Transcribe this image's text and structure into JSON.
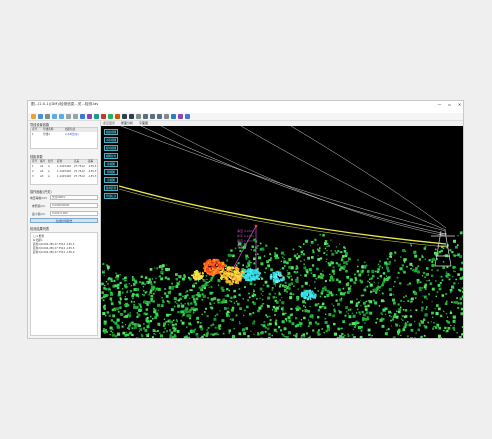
{
  "window": {
    "title": "图...(2.0-1)(DM)/检测信息...关...检测.las"
  },
  "titlebar": {
    "minimize": "—",
    "maximize": "▫",
    "close": "✕"
  },
  "menu": [
    "文件(F)",
    "检测(D)",
    "显示",
    "编辑(E)",
    "工具(T)",
    "帮助(H)"
  ],
  "toolbar": {
    "icons": [
      "open-icon",
      "save-icon",
      "undo-icon",
      "zoom-in-icon",
      "zoom-out-icon",
      "pan-icon",
      "rotate-icon",
      "select-icon",
      "measure-icon",
      "ruler-icon",
      "cut-icon",
      "layer-icon",
      "color-icon",
      "point-icon",
      "line-icon",
      "box-icon",
      "view-front-icon",
      "view-top-icon",
      "view-side-icon",
      "settings-icon",
      "export-icon",
      "report-icon",
      "help-icon"
    ]
  },
  "left_panel": {
    "section1": {
      "title": "导线设置线路",
      "columns": [
        "序号",
        "导线名称",
        "档距信息"
      ],
      "rows": [
        {
          "c1": "1",
          "c2": "导线1",
          "c3": "2-3#档(左)"
        }
      ]
    },
    "section2": {
      "title": "档距参数",
      "columns": [
        "序号",
        "编号",
        "档号",
        "距离",
        "高差",
        "弧垂"
      ],
      "rows": [
        {
          "c1": "1",
          "c2": "A1",
          "c3": "A",
          "c4": "1.1415402",
          "c5": "27.7512",
          "c6": "-135.3"
        },
        {
          "c1": "2",
          "c2": "A2",
          "c3": "A",
          "c4": "1.1415402",
          "c5": "27.7512",
          "c6": "-135.3"
        },
        {
          "c1": "3",
          "c2": "A3",
          "c3": "A",
          "c4": "1.1415402",
          "c5": "27.7512",
          "c6": "-135.3"
        }
      ]
    },
    "section3": {
      "title": "操作面板(开关)",
      "fields": [
        {
          "label": "电压等级(kV)",
          "value": "交流500kV"
        },
        {
          "label": "参照值(m)",
          "value": "0.000000000"
        },
        {
          "label": "最小值(m)",
          "value": "0.000 0.000"
        }
      ],
      "button": "生成检测报告"
    },
    "section4": {
      "title": "检测结果列表",
      "tree": [
        "□ 1 检测",
        "  ⊟ 档距1",
        "    距离1(0.002-2B) 27.7512 -135.3",
        "    距离2(0.002-2B) 27.7512 -135.3",
        "    距离3(0.002-2B) 27.7512 -136.0"
      ]
    }
  },
  "view": {
    "tabs": [
      "点云显示",
      "断面分析",
      "平面图"
    ],
    "side_buttons": [
      "缩放视图",
      "平移视图",
      "旋转视图",
      "视图复位",
      "前视图",
      "侧视图",
      "顶视图",
      "量测距离",
      "导线标注"
    ],
    "labels": [
      "净空 3.24m",
      "水平 2.10m",
      "垂直 1.97m",
      "安全 ✓"
    ],
    "colors": {
      "background": "#000000",
      "vegetation": "#2fd34a",
      "conductor": "#e8e84a",
      "wire": "#d8d8d8",
      "warning_red": "#ff3b1f",
      "warning_orange": "#ff9a1a",
      "cyan": "#2fd6e0",
      "measure": "#d050d0"
    }
  }
}
